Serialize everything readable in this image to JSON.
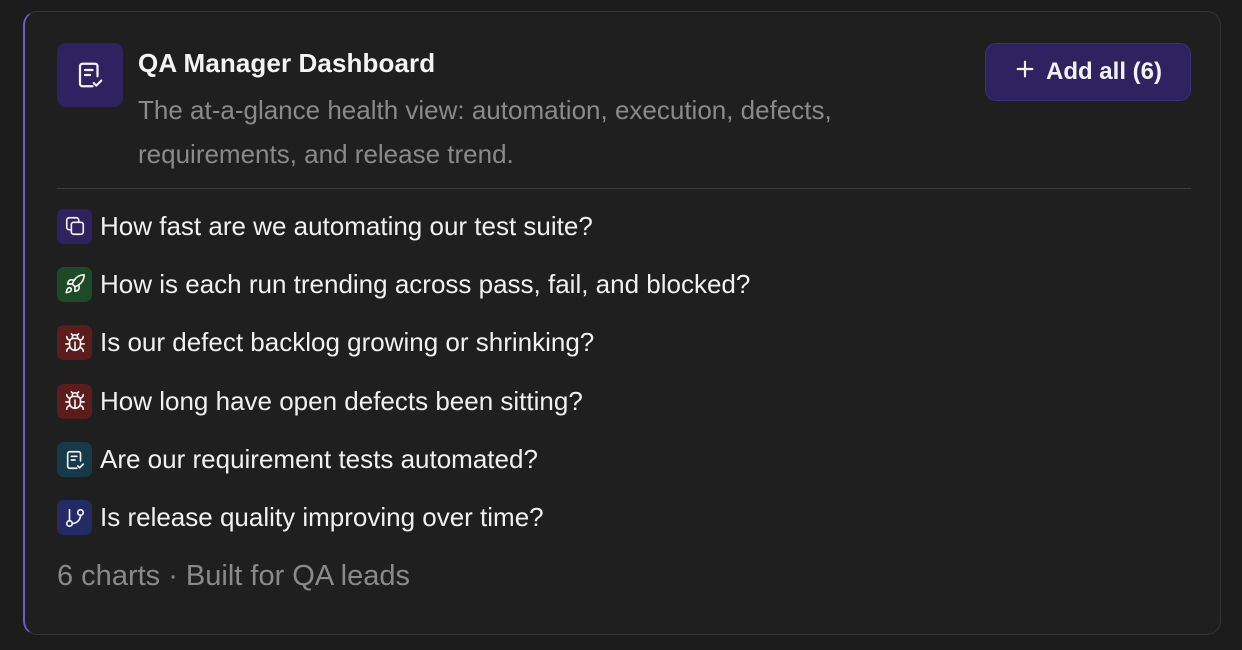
{
  "dashboard": {
    "title": "QA Manager Dashboard",
    "description": "The at-a-glance health view: automation, execution, defects, requirements, and release trend.",
    "add_all_label": "Add all (6)",
    "header_icon": "checklist-doc-icon",
    "accent_color": "#6b5bd6"
  },
  "questions": [
    {
      "text": "How fast are we automating our test suite?",
      "icon": "copy-stack-icon",
      "color": "#2e2360"
    },
    {
      "text": "How is each run trending across pass, fail, and blocked?",
      "icon": "rocket-icon",
      "color": "#1e4a26"
    },
    {
      "text": "Is our defect backlog growing or shrinking?",
      "icon": "bug-icon",
      "color": "#5a1c1c"
    },
    {
      "text": "How long have open defects been sitting?",
      "icon": "bug-icon",
      "color": "#5a1c1c"
    },
    {
      "text": "Are our requirement tests automated?",
      "icon": "checklist-doc-icon",
      "color": "#17394a"
    },
    {
      "text": "Is release quality improving over time?",
      "icon": "git-branch-icon",
      "color": "#242a66"
    }
  ],
  "footer": {
    "text": "6 charts · Built for QA leads"
  }
}
